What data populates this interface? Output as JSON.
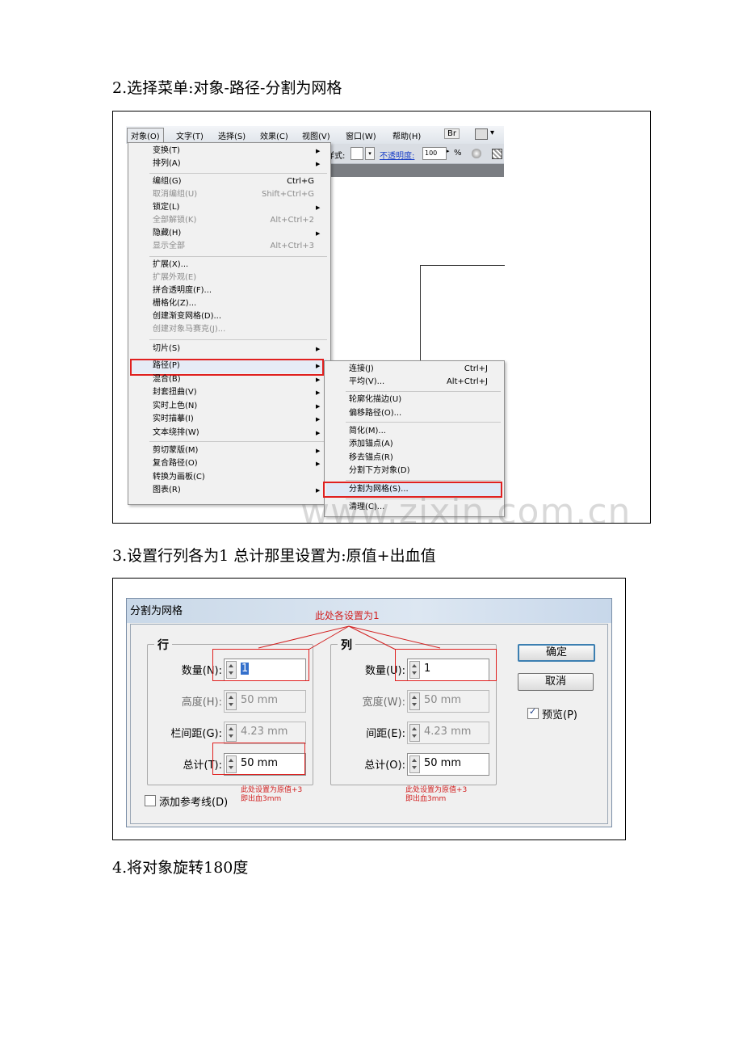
{
  "steps": {
    "s2": "2.选择菜单:对象-路径-分割为网格",
    "s3": "3.设置行列各为1  总计那里设置为:原值+出血值",
    "s4": "4.将对象旋转180度"
  },
  "shot1": {
    "menubar": [
      "对象(O)",
      "文字(T)",
      "选择(S)",
      "效果(C)",
      "视图(V)",
      "窗口(W)",
      "帮助(H)",
      "Br"
    ],
    "toolstrip": {
      "style_label": "样式:",
      "opacity_label": "不透明度:",
      "opacity_value": "100",
      "percent": "%"
    },
    "menu_object": [
      {
        "label": "变换(T)",
        "sub": true
      },
      {
        "label": "排列(A)",
        "sub": true
      },
      {
        "label": "编组(G)",
        "shortcut": "Ctrl+G"
      },
      {
        "label": "取消编组(U)",
        "shortcut": "Shift+Ctrl+G",
        "disabled": true
      },
      {
        "label": "锁定(L)",
        "sub": true
      },
      {
        "label": "全部解锁(K)",
        "shortcut": "Alt+Ctrl+2",
        "disabled": true
      },
      {
        "label": "隐藏(H)",
        "sub": true
      },
      {
        "label": "显示全部",
        "shortcut": "Alt+Ctrl+3",
        "disabled": true
      },
      {
        "label": "扩展(X)..."
      },
      {
        "label": "扩展外观(E)",
        "disabled": true
      },
      {
        "label": "拼合透明度(F)..."
      },
      {
        "label": "栅格化(Z)..."
      },
      {
        "label": "创建渐变网格(D)..."
      },
      {
        "label": "创建对象马赛克(J)...",
        "disabled": true
      },
      {
        "label": "切片(S)",
        "sub": true
      },
      {
        "label": "路径(P)",
        "sub": true
      },
      {
        "label": "混合(B)",
        "sub": true
      },
      {
        "label": "封套扭曲(V)",
        "sub": true
      },
      {
        "label": "实时上色(N)",
        "sub": true
      },
      {
        "label": "实时描摹(I)",
        "sub": true
      },
      {
        "label": "文本绕排(W)",
        "sub": true
      },
      {
        "label": "剪切蒙版(M)",
        "sub": true
      },
      {
        "label": "复合路径(O)",
        "sub": true
      },
      {
        "label": "转换为画板(C)"
      },
      {
        "label": "图表(R)",
        "sub": true
      }
    ],
    "menu_path": [
      {
        "label": "连接(J)",
        "shortcut": "Ctrl+J"
      },
      {
        "label": "平均(V)...",
        "shortcut": "Alt+Ctrl+J"
      },
      {
        "label": "轮廓化描边(U)"
      },
      {
        "label": "偏移路径(O)..."
      },
      {
        "label": "简化(M)..."
      },
      {
        "label": "添加锚点(A)"
      },
      {
        "label": "移去锚点(R)"
      },
      {
        "label": "分割下方对象(D)"
      },
      {
        "label": "分割为网格(S)..."
      },
      {
        "label": "清理(C)..."
      }
    ],
    "watermark": "www.zixin.com.cn"
  },
  "shot2": {
    "title": "分割为网格",
    "annotation_top": "此处各设置为1",
    "rows": {
      "group": "行",
      "count_label": "数量(N):",
      "count": "1",
      "height_label": "高度(H):",
      "height": "50 mm",
      "gutter_label": "栏间距(G):",
      "gutter": "4.23 mm",
      "total_label": "总计(T):",
      "total": "50 mm"
    },
    "cols": {
      "group": "列",
      "count_label": "数量(U):",
      "count": "1",
      "width_label": "宽度(W):",
      "width": "50 mm",
      "gutter_label": "间距(E):",
      "gutter": "4.23 mm",
      "total_label": "总计(O):",
      "total": "50 mm"
    },
    "ok": "确定",
    "cancel": "取消",
    "preview": "预览(P)",
    "preview_checked": true,
    "add_guides": "添加参考线(D)",
    "note_rows": [
      "此处设置为原值+3",
      "即出血3mm"
    ],
    "note_cols": [
      "此处设置为原值+3",
      "即出血3mm"
    ]
  }
}
